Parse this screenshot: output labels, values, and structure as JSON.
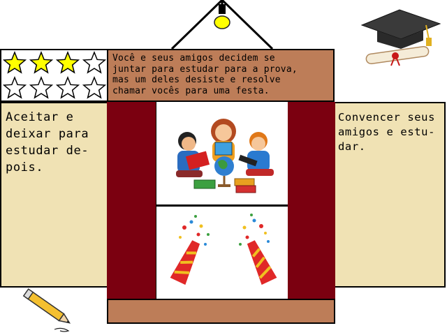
{
  "question": {
    "lines": [
      "Você e seus amigos decidem se",
      "juntar para estudar para a prova,",
      "mas um deles desiste e resolve",
      "chamar vocês para uma festa."
    ]
  },
  "options": {
    "left": {
      "lines": [
        "Aceitar e",
        "deixar para",
        "estudar de-",
        "pois."
      ]
    },
    "right": {
      "lines": [
        "Convencer seus",
        "amigos e estu-",
        "dar."
      ]
    }
  },
  "stars": {
    "filled": 3,
    "total": 4,
    "rows": 2,
    "filled_color": "#ffff00",
    "empty_color": "#ffffff"
  },
  "colors": {
    "curtain": "#7b0010",
    "panel_brown": "#bd7d58",
    "option_bg": "#f0e2b4",
    "lamp": "#ffff00"
  },
  "icons": {
    "lamp": "hanging-lamp-icon",
    "cap": "graduation-cap-icon",
    "diploma": "diploma-icon",
    "pencil": "pencil-icon",
    "study": "children-studying-illustration",
    "party": "party-poppers-illustration"
  }
}
